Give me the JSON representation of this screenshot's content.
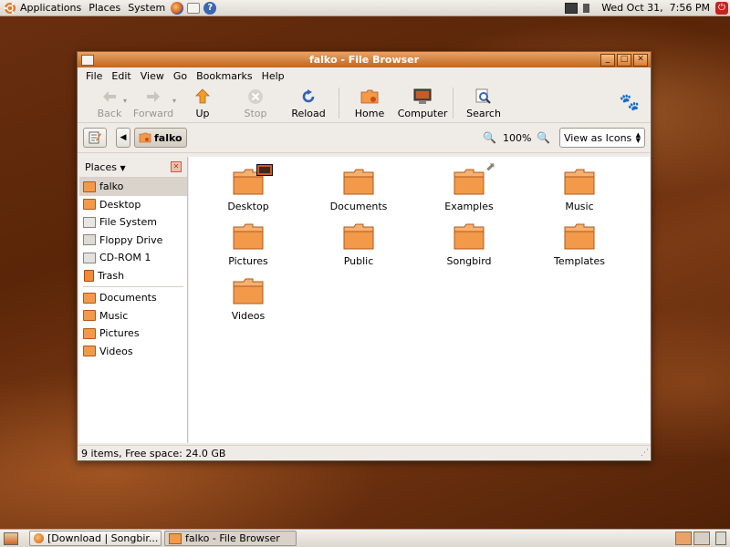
{
  "top_panel": {
    "menus": [
      "Applications",
      "Places",
      "System"
    ],
    "clock": "Wed Oct 31,  7:56 PM"
  },
  "window": {
    "title": "falko - File Browser",
    "menu": [
      "File",
      "Edit",
      "View",
      "Go",
      "Bookmarks",
      "Help"
    ],
    "toolbar": {
      "back": "Back",
      "forward": "Forward",
      "up": "Up",
      "stop": "Stop",
      "reload": "Reload",
      "home": "Home",
      "computer": "Computer",
      "search": "Search"
    },
    "location": {
      "path_button": "falko",
      "zoom": "100%",
      "view_mode": "View as Icons"
    },
    "sidebar": {
      "header": "Places",
      "places": [
        {
          "label": "falko",
          "icon": "home-folder-icon"
        },
        {
          "label": "Desktop",
          "icon": "desktop-folder-icon"
        },
        {
          "label": "File System",
          "icon": "filesystem-icon"
        },
        {
          "label": "Floppy Drive",
          "icon": "floppy-icon"
        },
        {
          "label": "CD-ROM 1",
          "icon": "cdrom-icon"
        },
        {
          "label": "Trash",
          "icon": "trash-icon"
        }
      ],
      "bookmarks": [
        {
          "label": "Documents",
          "icon": "folder-icon"
        },
        {
          "label": "Music",
          "icon": "folder-icon"
        },
        {
          "label": "Pictures",
          "icon": "folder-icon"
        },
        {
          "label": "Videos",
          "icon": "folder-icon"
        }
      ]
    },
    "items": [
      "Desktop",
      "Documents",
      "Examples",
      "Music",
      "Pictures",
      "Public",
      "Songbird",
      "Templates",
      "Videos"
    ],
    "status": "9 items, Free space: 24.0 GB"
  },
  "bottom_panel": {
    "tasks": [
      "[Download | Songbir...",
      "falko - File Browser"
    ]
  },
  "colors": {
    "accent": "#e2772a",
    "folder": "#f29a4a",
    "desktop_bg": "#5a2508"
  }
}
